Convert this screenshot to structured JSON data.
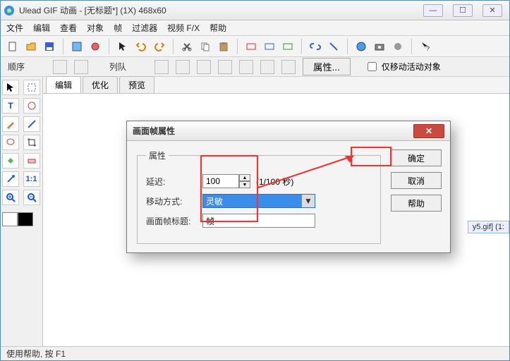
{
  "window": {
    "title": "Ulead GIF 动画 - [无标题*] (1X) 468x60"
  },
  "menubar": [
    "文件",
    "编辑",
    "查看",
    "对象",
    "帧",
    "过滤器",
    "视频 F/X",
    "帮助"
  ],
  "subbar": {
    "label1": "顺序",
    "label2": "列队",
    "prop_btn": "属性...",
    "checkbox": "仅移动活动对象"
  },
  "tabs": {
    "edit": "编辑",
    "optimize": "优化",
    "preview": "预览"
  },
  "filechip": "y5.gif] (1:",
  "statusbar": "使用帮助, 按 F1",
  "dialog": {
    "title": "画面帧属性",
    "legend": "属性",
    "delay_label": "延迟:",
    "delay_value": "100",
    "delay_unit": "(1/100 秒)",
    "move_label": "移动方式:",
    "move_value": "灵敏",
    "frametitle_label": "画面帧标题:",
    "frametitle_value": "帧",
    "ok": "确定",
    "cancel": "取消",
    "help": "帮助"
  },
  "toolbox_text": {
    "t": "T",
    "ratio": "1:1"
  }
}
